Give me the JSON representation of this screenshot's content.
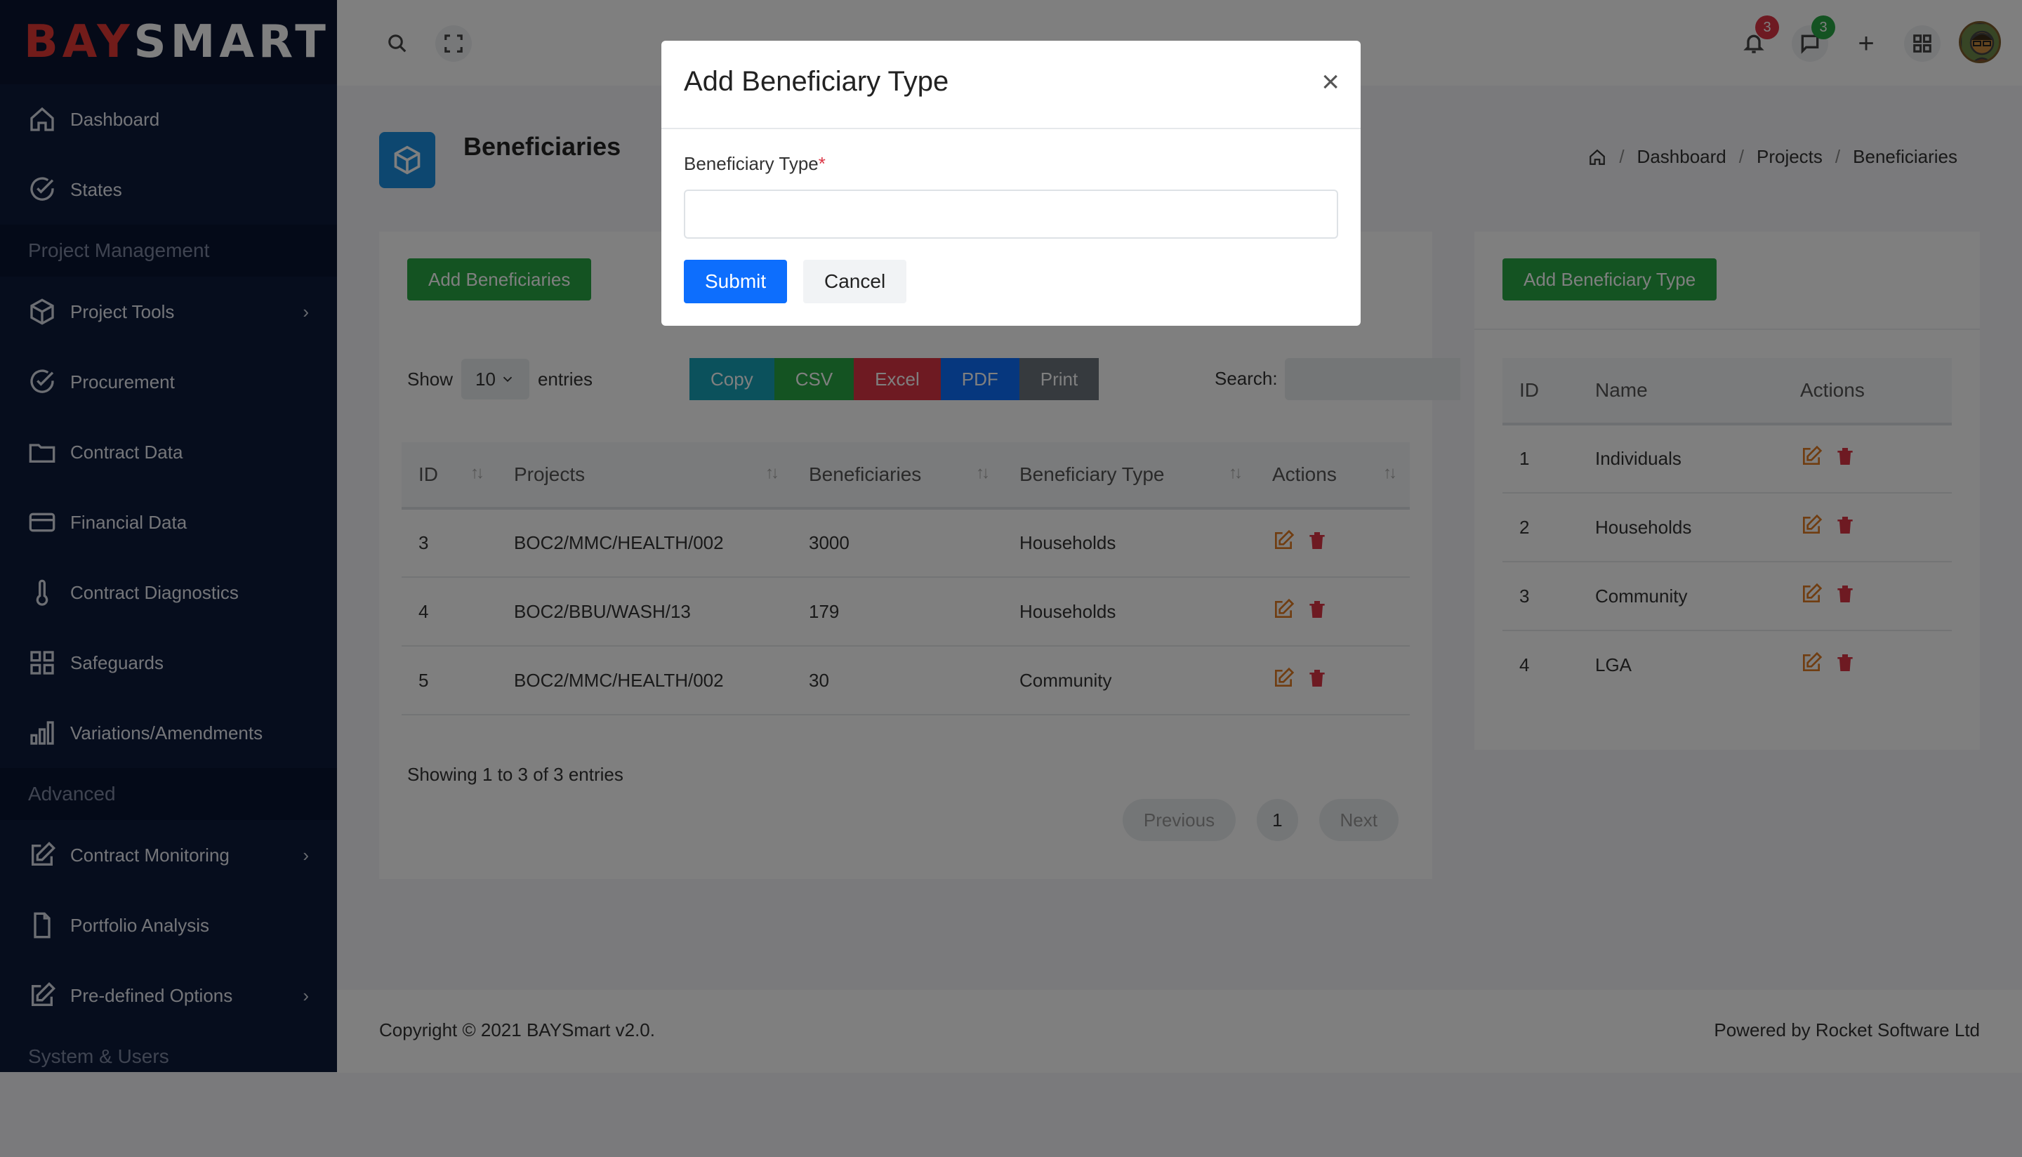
{
  "app": {
    "logo_part1": "BAY",
    "logo_part2": "SMART"
  },
  "sidebar": {
    "items_top": [
      {
        "label": "Dashboard",
        "icon": "home-icon"
      },
      {
        "label": "States",
        "icon": "check-circle-icon"
      }
    ],
    "section1": "Project Management",
    "items_pm": [
      {
        "label": "Project Tools",
        "icon": "box-icon",
        "chevron": "›"
      },
      {
        "label": "Procurement",
        "icon": "check-circle-icon"
      },
      {
        "label": "Contract Data",
        "icon": "folder-icon"
      },
      {
        "label": "Financial Data",
        "icon": "credit-card-icon"
      },
      {
        "label": "Contract Diagnostics",
        "icon": "thermometer-icon"
      },
      {
        "label": "Safeguards",
        "icon": "grid-icon"
      },
      {
        "label": "Variations/Amendments",
        "icon": "bar-chart-icon"
      }
    ],
    "section2": "Advanced",
    "items_adv": [
      {
        "label": "Contract Monitoring",
        "icon": "edit-icon",
        "chevron": "›"
      },
      {
        "label": "Portfolio Analysis",
        "icon": "file-icon"
      },
      {
        "label": "Pre-defined Options",
        "icon": "edit-icon",
        "chevron": "›"
      }
    ],
    "section3": "System & Users"
  },
  "topbar": {
    "notifications_count": "3",
    "messages_count": "3",
    "plus_label": "+",
    "colors": {
      "notif_badge": "#dc3545",
      "msg_badge": "#28a745"
    }
  },
  "page": {
    "title": "Beneficiaries",
    "breadcrumb": [
      "Dashboard",
      "Projects",
      "Beneficiaries"
    ],
    "breadcrumb_sep": "/"
  },
  "left_card": {
    "add_button": "Add Beneficiaries",
    "show_label": "Show",
    "entries_value": "10",
    "entries_label": "entries",
    "export_buttons": [
      {
        "label": "Copy",
        "color": "#17a2b8"
      },
      {
        "label": "CSV",
        "color": "#28a745"
      },
      {
        "label": "Excel",
        "color": "#dc3545"
      },
      {
        "label": "PDF",
        "color": "#0d6efd"
      },
      {
        "label": "Print",
        "color": "#6c757d"
      }
    ],
    "search_label": "Search:",
    "columns": [
      "ID",
      "Projects",
      "Beneficiaries",
      "Beneficiary Type",
      "Actions"
    ],
    "rows": [
      {
        "id": "3",
        "project": "BOC2/MMC/HEALTH/002",
        "beneficiaries": "3000",
        "type": "Households"
      },
      {
        "id": "4",
        "project": "BOC2/BBU/WASH/13",
        "beneficiaries": "179",
        "type": "Households"
      },
      {
        "id": "5",
        "project": "BOC2/MMC/HEALTH/002",
        "beneficiaries": "30",
        "type": "Community"
      }
    ],
    "info": "Showing 1 to 3 of 3 entries",
    "pager": {
      "prev": "Previous",
      "page": "1",
      "next": "Next"
    }
  },
  "right_card": {
    "add_button": "Add Beneficiary Type",
    "columns": [
      "ID",
      "Name",
      "Actions"
    ],
    "rows": [
      {
        "id": "1",
        "name": "Individuals"
      },
      {
        "id": "2",
        "name": "Households"
      },
      {
        "id": "3",
        "name": "Community"
      },
      {
        "id": "4",
        "name": "LGA"
      }
    ]
  },
  "footer": {
    "left": "Copyright © 2021 BAYSmart v2.0.",
    "right": "Powered by Rocket Software Ltd"
  },
  "modal": {
    "title": "Add Beneficiary Type",
    "close": "×",
    "field_label": "Beneficiary Type",
    "required_mark": "*",
    "field_value": "",
    "submit": "Submit",
    "cancel": "Cancel"
  }
}
